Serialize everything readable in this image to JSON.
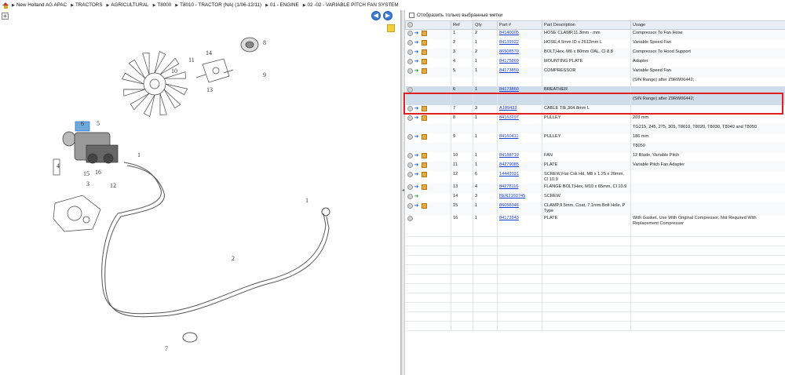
{
  "breadcrumb": [
    "New Holland AG APAC",
    "TRACTORS",
    "AGRICULTURAL",
    "T8000",
    "T8010 - TRACTOR (NA) (1/06-12/11)",
    "01 - ENGINE",
    "02 -02 - VARIABLE PITCH FAN SYSTEM"
  ],
  "toolbar": {
    "plus_label": "+",
    "prev_label": "◀",
    "next_label": "▶"
  },
  "filter_label": "Отобразить только выбранные метки",
  "columns": {
    "ref": "Ref",
    "qty": "Qty",
    "part": "Part #",
    "desc": "Part Description",
    "usage": "Usage"
  },
  "rows": [
    {
      "ref": "1",
      "qty": "2",
      "part": "84140005",
      "desc": "HOSE CLAMP,11.3mm - mm",
      "usage": "Compressor To Fan Hose"
    },
    {
      "ref": "2",
      "qty": "1",
      "part": "84139922",
      "desc": "HOSE,4.5mm ID x 2612mm L",
      "usage": "Variable Speed Fan"
    },
    {
      "ref": "3",
      "qty": "2",
      "part": "86508570",
      "desc": "BOLT,Hex, M6 x 80mm OAL, Cl 8.8",
      "usage": "Compressor To Hood Support"
    },
    {
      "ref": "4",
      "qty": "1",
      "part": "84175869",
      "desc": "MOUNTING PLATE",
      "usage": "Adapter"
    },
    {
      "ref": "5",
      "qty": "1",
      "part": "84173859",
      "desc": "COMPRESSOR",
      "usage": "Variable Speed Fan",
      "extra": "(S/N Range) after Z9RW06442;"
    },
    {
      "ref": "6",
      "qty": "1",
      "part": "84173860",
      "desc": "BREATHER",
      "usage": "",
      "extra": "(S/N Range) after Z9RW06442;"
    },
    {
      "ref": "7",
      "qty": "3",
      "part": "A189433",
      "desc": "CABLE TIE,304.8mm L",
      "usage": ""
    },
    {
      "ref": "8",
      "qty": "1",
      "part": "84163207",
      "desc": "PULLEY",
      "usage": "203 mm",
      "extra": "TG215, 245, 275, 305, T8010, T8020, T8030, T8040 and T8050"
    },
    {
      "ref": "9",
      "qty": "1",
      "part": "84160411",
      "desc": "PULLEY",
      "usage": "186 mm",
      "extra": "T8050"
    },
    {
      "ref": "10",
      "qty": "1",
      "part": "84188710",
      "desc": "FAN",
      "usage": "12 Blade, Variable Pitch"
    },
    {
      "ref": "11",
      "qty": "1",
      "part": "84279085",
      "desc": "PLATE",
      "usage": "Variable Pitch Fan Adapter"
    },
    {
      "ref": "12",
      "qty": "6",
      "part": "14442031",
      "desc": "SCREW,Flat Csk Hd, M8 x 1.25 x 20mm, Cl 10.9",
      "usage": ""
    },
    {
      "ref": "13",
      "qty": "4",
      "part": "84278116",
      "desc": "FLANGE BOLT,Hex, M10 x 65mm, Cl 10.9",
      "usage": ""
    },
    {
      "ref": "14",
      "qty": "3",
      "part": "BER2169745",
      "desc": "SCREW",
      "usage": ""
    },
    {
      "ref": "15",
      "qty": "1",
      "part": "86058346",
      "desc": "CLAMP,9.5mm, Coat, 7.1mm Bolt Hole, P Type",
      "usage": ""
    },
    {
      "ref": "16",
      "qty": "1",
      "part": "84173943",
      "desc": "PLATE",
      "usage": "With Gasket, Use With Original Compressor, Not Required With Replacement Compressor"
    }
  ],
  "diagram_labels": [
    "11",
    "14",
    "10",
    "8",
    "9",
    "13",
    "5",
    "6",
    "1",
    "3",
    "16",
    "1",
    "2",
    "7",
    "4",
    "15",
    "12"
  ]
}
